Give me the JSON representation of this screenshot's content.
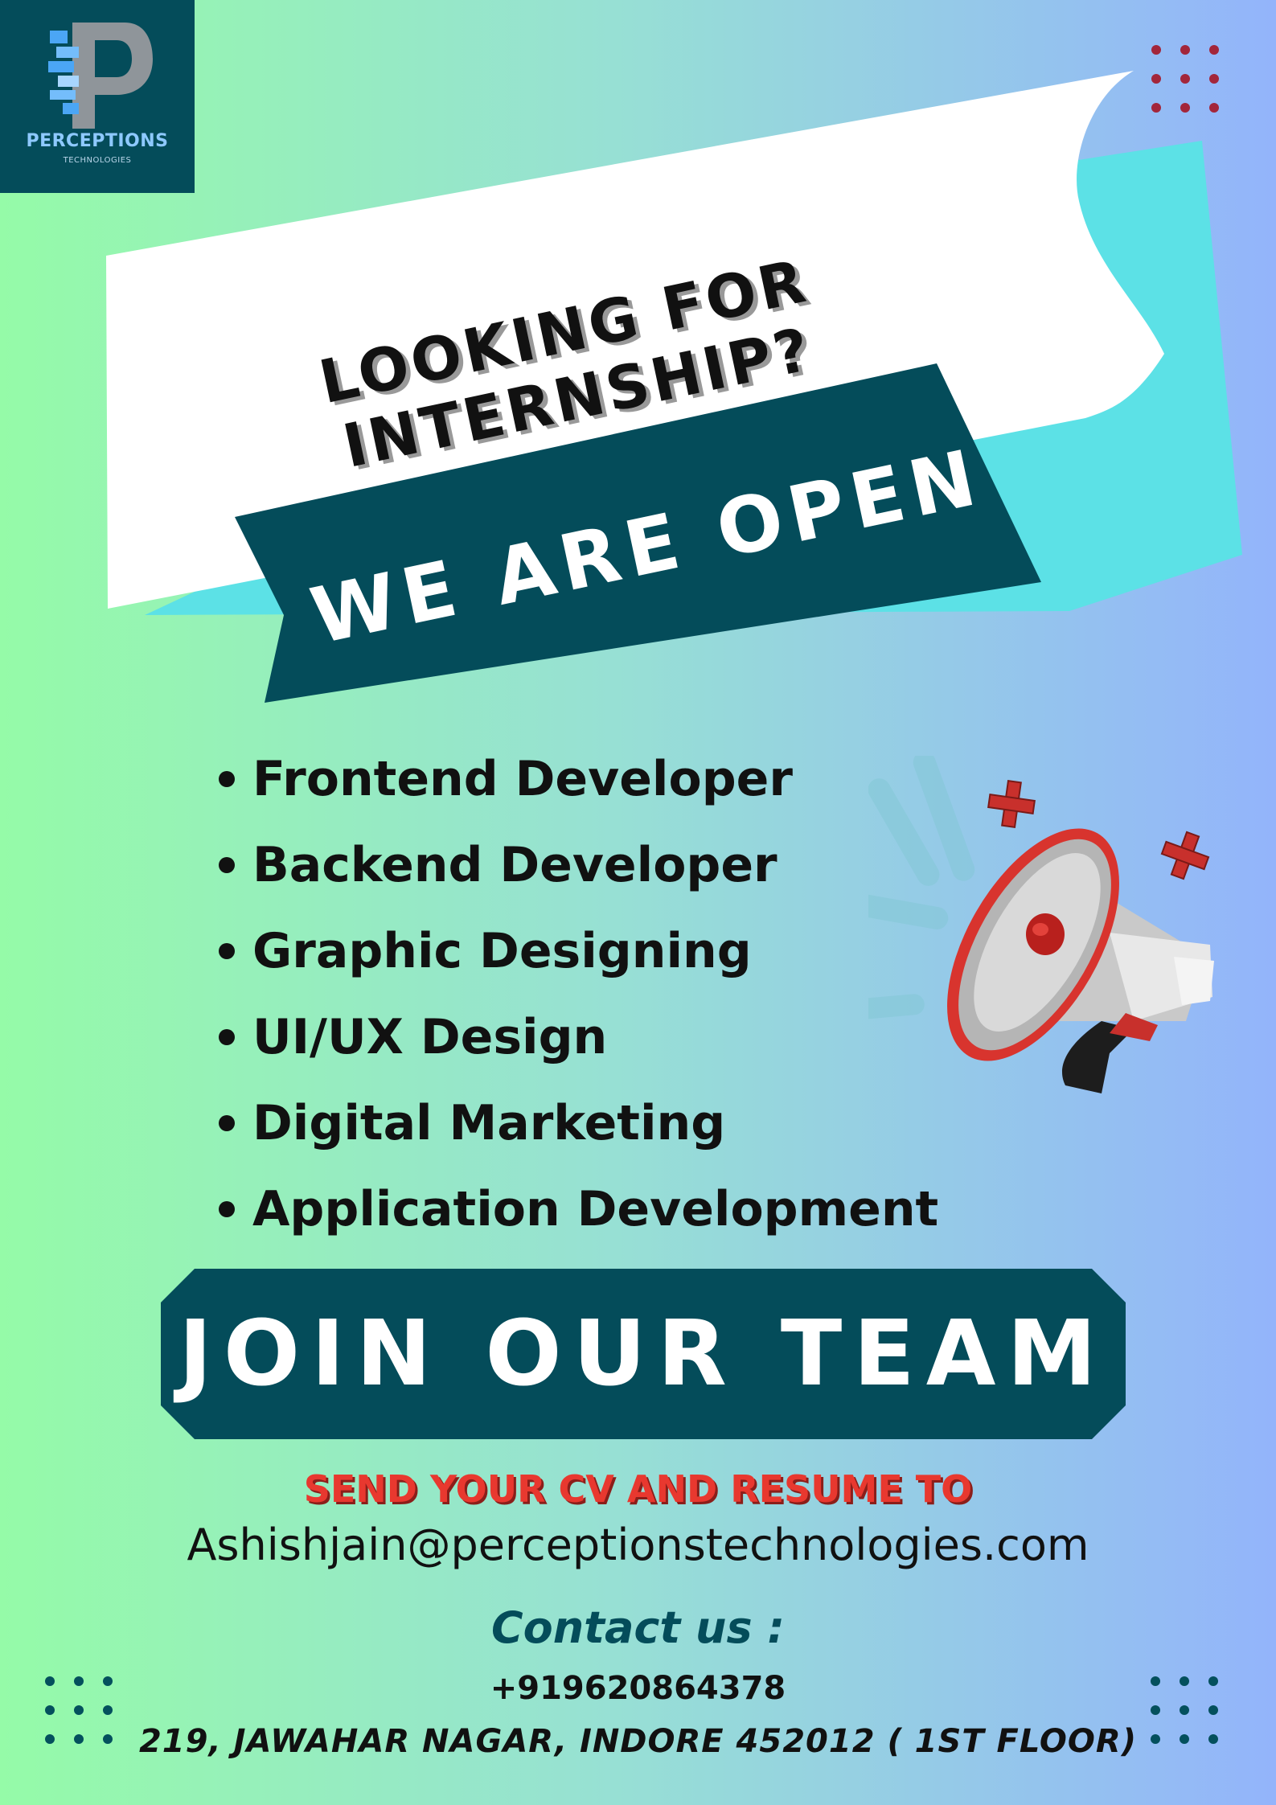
{
  "brand": {
    "name": "PERCEPTIONS",
    "tagline": "TECHNOLOGIES"
  },
  "headline": {
    "line1": "LOOKING FOR",
    "line2": "INTERNSHIP?"
  },
  "banner": {
    "label": "WE ARE OPEN"
  },
  "positions": [
    "Frontend Developer",
    "Backend Developer",
    "Graphic Designing",
    "UI/UX Design",
    "Digital Marketing",
    "Application Development"
  ],
  "cta": {
    "label": "JOIN OUR TEAM"
  },
  "apply": {
    "heading": "SEND YOUR CV AND RESUME TO",
    "email": "Ashishjain@perceptionstechnologies.com"
  },
  "contact": {
    "heading": "Contact us :",
    "phone": "+919620864378",
    "address": "219, JAWAHAR NAGAR, INDORE 452012 ( 1ST FLOOR)"
  },
  "colors": {
    "teal_dark": "#044c5a",
    "accent_cyan": "#5ce1e6",
    "cta_red": "#e8382f",
    "dot_red": "#a3263b",
    "gradient_left": "#95fba8",
    "gradient_right": "#93b4fb"
  },
  "icons": [
    "megaphone-icon",
    "plus-icon",
    "logo-p-icon"
  ]
}
